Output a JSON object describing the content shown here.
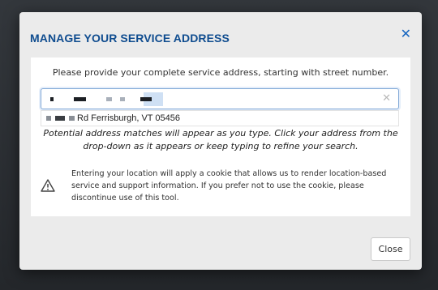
{
  "modal": {
    "title": "MANAGE YOUR SERVICE ADDRESS",
    "close_icon": "close-icon",
    "instruction": "Please provide your complete service address, starting with street number.",
    "input": {
      "value": "",
      "clear_icon": "clear-icon"
    },
    "suggestion": {
      "text": "Rd Ferrisburgh, VT 05456"
    },
    "hint": "Potential address matches will appear as you type. Click your address from the drop-down as it appears or keep typing to refine your search.",
    "cookie_notice": {
      "icon": "warning-icon",
      "text": "Entering your location will apply a cookie that allows us to render location-based service and support information. If you prefer not to use the cookie, please discontinue use of this tool."
    },
    "close_button": "Close"
  },
  "colors": {
    "title": "#0f4c8f",
    "close_icon": "#1565c0",
    "overlay": "#2a2d31",
    "modal_bg": "#ebebeb",
    "input_border": "#7fa7d6"
  }
}
